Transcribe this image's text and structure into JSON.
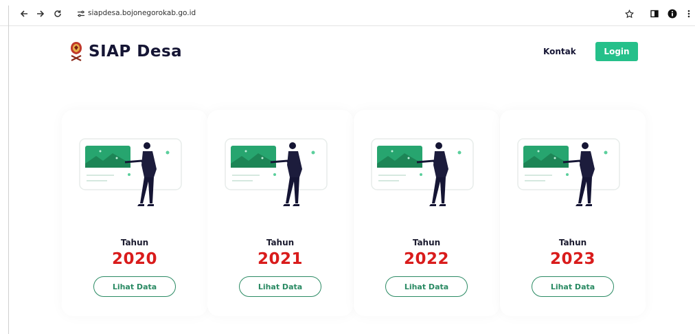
{
  "browser": {
    "url": "siapdesa.bojonegorokab.go.id",
    "icons": [
      "arrow-left-icon",
      "arrow-right-icon",
      "reload-icon",
      "site-settings-icon",
      "star-icon",
      "side-panel-icon",
      "profile-icon",
      "more-icon"
    ]
  },
  "header": {
    "title": "SIAP Desa",
    "nav_contact": "Kontak",
    "login_label": "Login"
  },
  "colors": {
    "accent_green": "#25c08a",
    "year_red": "#d91c1c",
    "outline_green": "#2a8a63",
    "dark_text": "#151534"
  },
  "cards": [
    {
      "label": "Tahun",
      "year": "2020",
      "button": "Lihat Data"
    },
    {
      "label": "Tahun",
      "year": "2021",
      "button": "Lihat Data"
    },
    {
      "label": "Tahun",
      "year": "2022",
      "button": "Lihat Data"
    },
    {
      "label": "Tahun",
      "year": "2023",
      "button": "Lihat Data"
    }
  ]
}
